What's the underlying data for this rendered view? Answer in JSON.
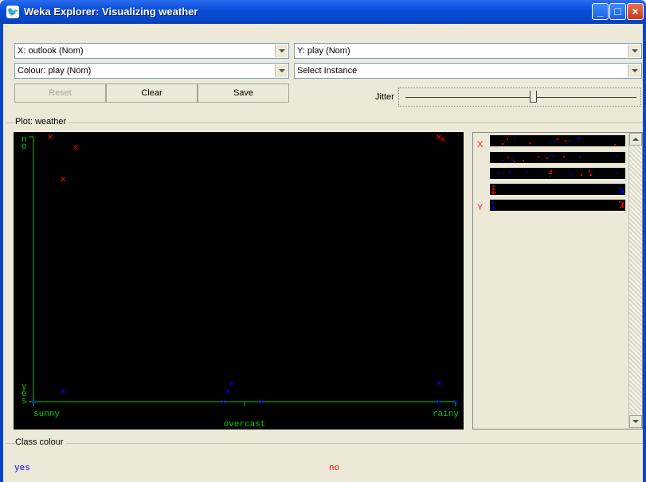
{
  "window": {
    "title": "Weka Explorer: Visualizing weather"
  },
  "controls": {
    "x_axis": "X: outlook (Nom)",
    "y_axis": "Y: play (Nom)",
    "colour": "Colour: play (Nom)",
    "select_instance": "Select Instance",
    "reset_label": "Reset",
    "clear_label": "Clear",
    "save_label": "Save",
    "jitter_label": "Jitter",
    "jitter_level": 0.55
  },
  "plot": {
    "group_label": "Plot: weather",
    "x_ticks": [
      "sunny",
      "overcast",
      "rainy"
    ],
    "y_ticks": [
      "yes",
      "no"
    ],
    "colors": {
      "background": "#000000",
      "axis": "#00cc00",
      "yes": "#0000ff",
      "no": "#ff0000"
    }
  },
  "chart_data": {
    "type": "scatter",
    "title": "",
    "xlabel": "outlook",
    "ylabel": "play",
    "x_categories": [
      "sunny",
      "overcast",
      "rainy"
    ],
    "y_categories": [
      "yes",
      "no"
    ],
    "series": [
      {
        "name": "no",
        "color": "#ff0000",
        "points": [
          {
            "x": "sunny",
            "y": "no",
            "jx": 0.1,
            "jy": 0.04
          },
          {
            "x": "sunny",
            "y": "no",
            "jx": 0.04,
            "jy": 0.0
          },
          {
            "x": "sunny",
            "y": "no",
            "jx": 0.07,
            "jy": 0.16
          },
          {
            "x": "rainy",
            "y": "no",
            "jx": -0.04,
            "jy": 0.0
          },
          {
            "x": "rainy",
            "y": "no",
            "jx": -0.03,
            "jy": 0.01
          }
        ]
      },
      {
        "name": "yes",
        "color": "#0000ff",
        "points": [
          {
            "x": "sunny",
            "y": "yes",
            "jx": 0.07,
            "jy": 0.04
          },
          {
            "x": "sunny",
            "y": "yes",
            "jx": 0.0,
            "jy": 0.0
          },
          {
            "x": "overcast",
            "y": "yes",
            "jx": -0.03,
            "jy": 0.07
          },
          {
            "x": "overcast",
            "y": "yes",
            "jx": -0.04,
            "jy": 0.04
          },
          {
            "x": "overcast",
            "y": "yes",
            "jx": -0.05,
            "jy": 0.0
          },
          {
            "x": "overcast",
            "y": "yes",
            "jx": 0.04,
            "jy": 0.0
          },
          {
            "x": "rainy",
            "y": "yes",
            "jx": -0.04,
            "jy": 0.07
          },
          {
            "x": "rainy",
            "y": "yes",
            "jx": -0.04,
            "jy": 0.0
          },
          {
            "x": "rainy",
            "y": "yes",
            "jx": 0.0,
            "jy": 0.0
          }
        ]
      }
    ]
  },
  "attribute_panel": {
    "x_label": "X",
    "y_label": "Y",
    "strip_count": 5
  },
  "class_colour": {
    "group_label": "Class colour",
    "classes": [
      {
        "name": "yes",
        "color": "#0000ff"
      },
      {
        "name": "no",
        "color": "#ff0000"
      }
    ]
  }
}
